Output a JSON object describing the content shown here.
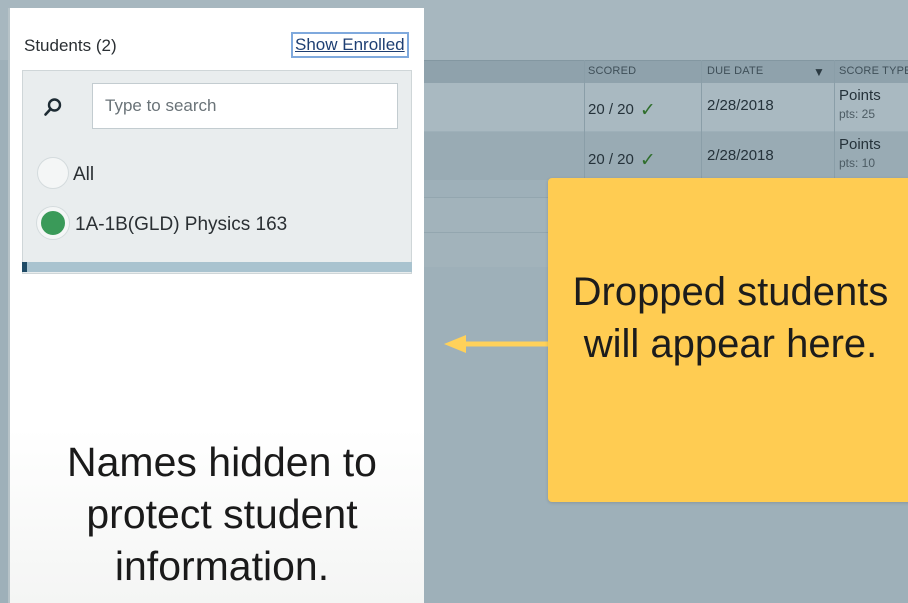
{
  "panel": {
    "title": "Students (2)",
    "show_enrolled_label": "Show Enrolled",
    "search": {
      "placeholder": "Type to search",
      "icon": "search-icon"
    },
    "options": [
      {
        "label": "All",
        "selected": false
      },
      {
        "label": "1A-1B(GLD) Physics 163",
        "selected": true
      }
    ],
    "note": "Names hidden to protect student information."
  },
  "table": {
    "headers": {
      "scored": "SCORED",
      "due_date": "DUE DATE",
      "score_type": "SCORE TYPE"
    },
    "rows": [
      {
        "scored": "20 / 20",
        "due_date": "2/28/2018",
        "score_type": "Points",
        "pts": "pts: 25"
      },
      {
        "scored": "20 / 20",
        "due_date": "2/28/2018",
        "score_type": "Points",
        "pts": "pts: 10"
      }
    ]
  },
  "callout": {
    "text": "Dropped students will appear here."
  },
  "colors": {
    "callout": "#ffcc52",
    "arrow": "#ffd15a",
    "selected_radio": "#3a9a59",
    "overlay": "#9eb0b9"
  }
}
